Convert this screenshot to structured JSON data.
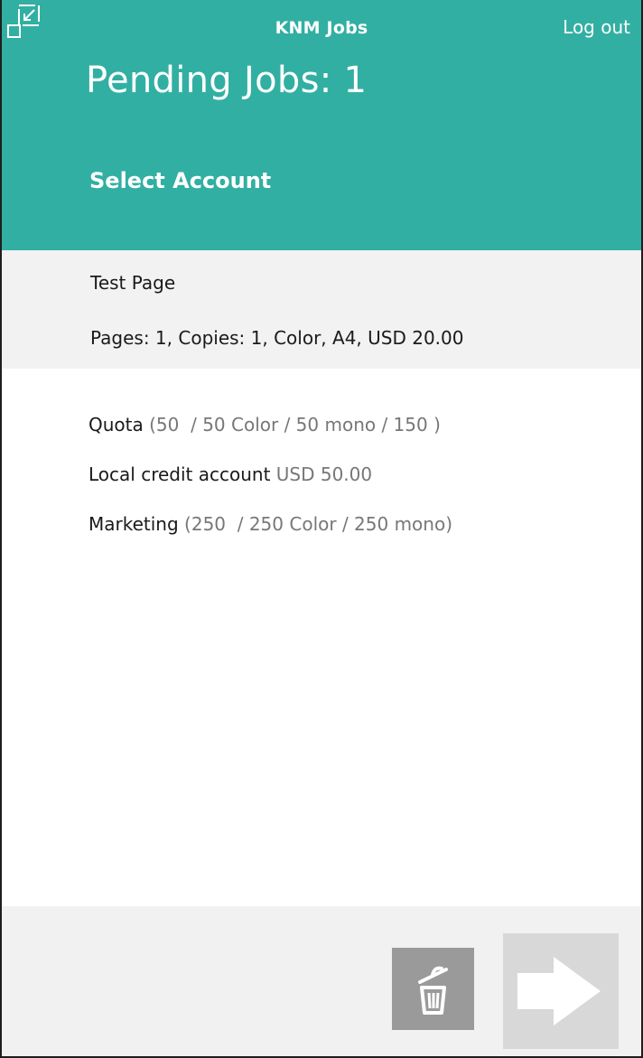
{
  "header": {
    "app_title": "KNM Jobs",
    "logout_label": "Log out",
    "page_title": "Pending Jobs: 1",
    "subtitle": "Select Account",
    "background_color": "#32afa3"
  },
  "job": {
    "name": "Test Page",
    "details": "Pages: 1, Copies: 1, Color, A4, USD 20.00"
  },
  "accounts": [
    {
      "name": "Quota",
      "detail": "(50  / 50 Color / 50 mono / 150 )"
    },
    {
      "name": "Local credit account",
      "detail": "USD 50.00"
    },
    {
      "name": "Marketing",
      "detail": "(250  / 250 Color / 250 mono)"
    }
  ],
  "footer": {
    "delete_icon": "trash-icon",
    "next_icon": "arrow-right-icon",
    "minimize_icon": "minimize-icon"
  }
}
